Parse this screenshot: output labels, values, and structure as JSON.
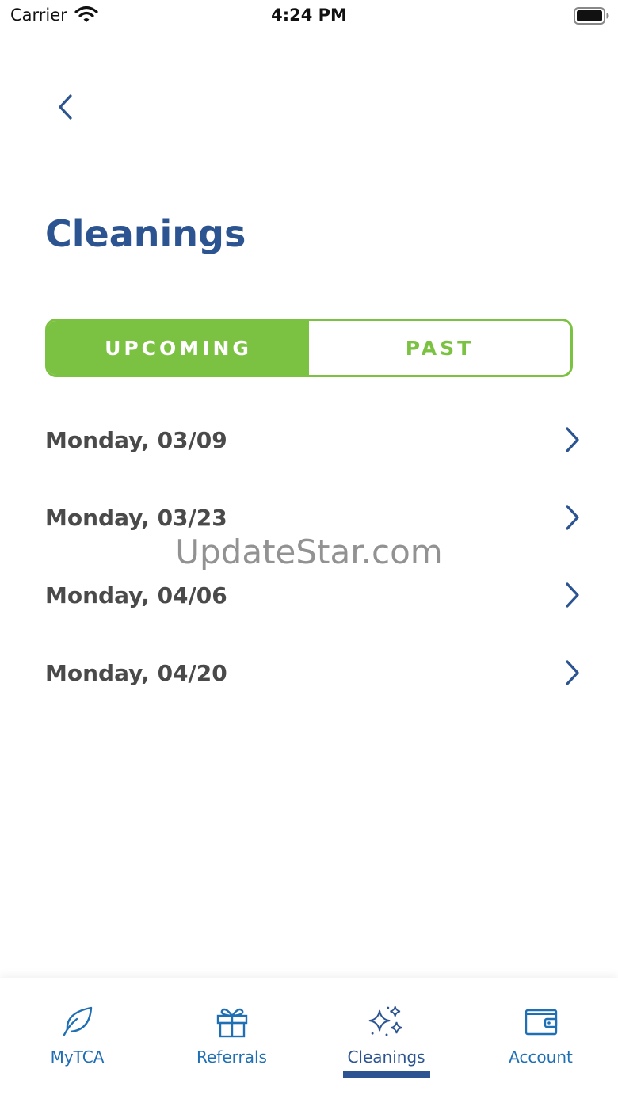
{
  "status_bar": {
    "carrier": "Carrier",
    "time": "4:24 PM",
    "icons": [
      "wifi-icon",
      "battery-icon"
    ]
  },
  "header": {
    "back_icon": "chevron-left-icon",
    "title": "Cleanings"
  },
  "segmented": {
    "upcoming_label": "UPCOMING",
    "past_label": "PAST",
    "selected": "upcoming"
  },
  "cleanings": [
    {
      "label": "Monday, 03/09"
    },
    {
      "label": "Monday, 03/23"
    },
    {
      "label": "Monday, 04/06"
    },
    {
      "label": "Monday, 04/20"
    }
  ],
  "watermark": "UpdateStar.com",
  "tabs": [
    {
      "label": "MyTCA",
      "icon": "leaf-icon"
    },
    {
      "label": "Referrals",
      "icon": "gift-icon"
    },
    {
      "label": "Cleanings",
      "icon": "sparkles-icon",
      "active": true
    },
    {
      "label": "Account",
      "icon": "wallet-icon"
    }
  ],
  "colors": {
    "brand_blue": "#2c5491",
    "tab_blue": "#1f6fb5",
    "accent_green": "#7cc242",
    "text_gray": "#4a4a4a"
  }
}
